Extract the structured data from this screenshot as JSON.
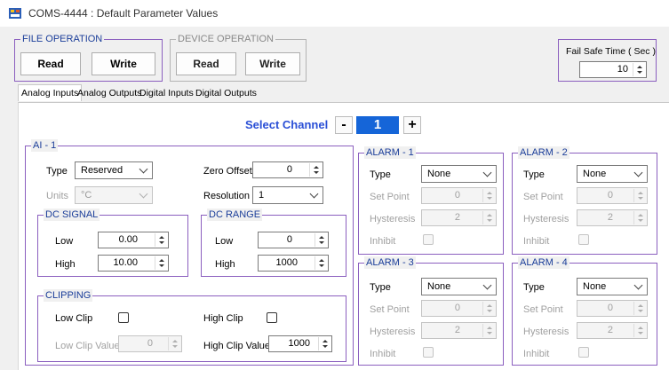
{
  "window": {
    "title": "COMS-4444 : Default Parameter Values"
  },
  "file_operation": {
    "label": "FILE OPERATION",
    "read": "Read",
    "write": "Write"
  },
  "device_operation": {
    "label": "DEVICE OPERATION",
    "read": "Read",
    "write": "Write"
  },
  "fail_safe": {
    "label": "Fail Safe Time ( Sec )",
    "value": "10"
  },
  "tabs": [
    {
      "label": "Analog Inputs",
      "active": true
    },
    {
      "label": "Analog Outputs"
    },
    {
      "label": "Digital Inputs"
    },
    {
      "label": "Digital Outputs"
    }
  ],
  "channel": {
    "label": "Select Channel",
    "minus": "-",
    "value": "1",
    "plus": "+"
  },
  "ai": {
    "label": "AI - 1",
    "type_label": "Type",
    "type_value": "Reserved",
    "units_label": "Units",
    "units_value": "°C",
    "zero_offset_label": "Zero Offset",
    "zero_offset_value": "0",
    "resolution_label": "Resolution",
    "resolution_value": "1",
    "dc_signal": {
      "label": "DC SIGNAL",
      "low_label": "Low",
      "low_value": "0.00",
      "high_label": "High",
      "high_value": "10.00"
    },
    "dc_range": {
      "label": "DC RANGE",
      "low_label": "Low",
      "low_value": "0",
      "high_label": "High",
      "high_value": "1000"
    },
    "clipping": {
      "label": "CLIPPING",
      "low_clip_label": "Low Clip",
      "high_clip_label": "High Clip",
      "low_clip_value_label": "Low Clip Value",
      "low_clip_value": "0",
      "high_clip_value_label": "High Clip Value",
      "high_clip_value": "1000"
    }
  },
  "alarms": [
    {
      "label": "ALARM - 1",
      "type_label": "Type",
      "type_value": "None",
      "set_point_label": "Set Point",
      "set_point": "0",
      "hysteresis_label": "Hysteresis",
      "hysteresis": "2",
      "inhibit_label": "Inhibit"
    },
    {
      "label": "ALARM - 2",
      "type_label": "Type",
      "type_value": "None",
      "set_point_label": "Set Point",
      "set_point": "0",
      "hysteresis_label": "Hysteresis",
      "hysteresis": "2",
      "inhibit_label": "Inhibit"
    },
    {
      "label": "ALARM - 3",
      "type_label": "Type",
      "type_value": "None",
      "set_point_label": "Set Point",
      "set_point": "0",
      "hysteresis_label": "Hysteresis",
      "hysteresis": "2",
      "inhibit_label": "Inhibit"
    },
    {
      "label": "ALARM - 4",
      "type_label": "Type",
      "type_value": "None",
      "set_point_label": "Set Point",
      "set_point": "0",
      "hysteresis_label": "Hysteresis",
      "hysteresis": "2",
      "inhibit_label": "Inhibit"
    }
  ]
}
